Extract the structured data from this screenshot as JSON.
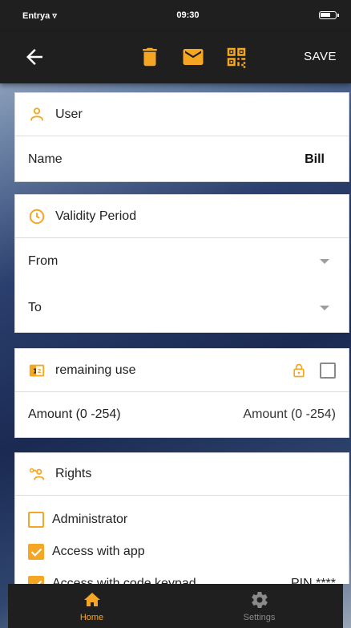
{
  "status_bar": {
    "carrier": "Entrya",
    "time": "09:30"
  },
  "toolbar": {
    "back_icon": "arrow-left-icon",
    "icons": [
      "trash-icon",
      "mail-icon",
      "qr-code-icon"
    ],
    "save_label": "SAVE"
  },
  "user_card": {
    "title": "User",
    "icon": "person-icon",
    "name_label": "Name",
    "name_value": "Bill"
  },
  "validity_card": {
    "title": "Validity Period",
    "icon": "clock-icon",
    "from_label": "From",
    "to_label": "To"
  },
  "remaining_card": {
    "title": "remaining use",
    "icon": "counter-icon",
    "lock_icon": "lock-icon",
    "amount_label": "Amount (0 -254)",
    "amount_placeholder": "Amount (0 -254)"
  },
  "rights_card": {
    "title": "Rights",
    "icon": "key-person-icon",
    "items": [
      {
        "label": "Administrator",
        "checked": false,
        "extra": ""
      },
      {
        "label": "Access with app",
        "checked": true,
        "extra": ""
      },
      {
        "label": "Access with code keypad",
        "checked": true,
        "extra": "PIN ****"
      }
    ]
  },
  "bottom_nav": {
    "items": [
      {
        "label": "Home",
        "icon": "home-icon",
        "active": true
      },
      {
        "label": "Settings",
        "icon": "gear-icon",
        "active": false
      }
    ]
  },
  "colors": {
    "accent": "#f5a623",
    "bar": "#1f1f1f",
    "inactive": "#8a8a8a"
  }
}
